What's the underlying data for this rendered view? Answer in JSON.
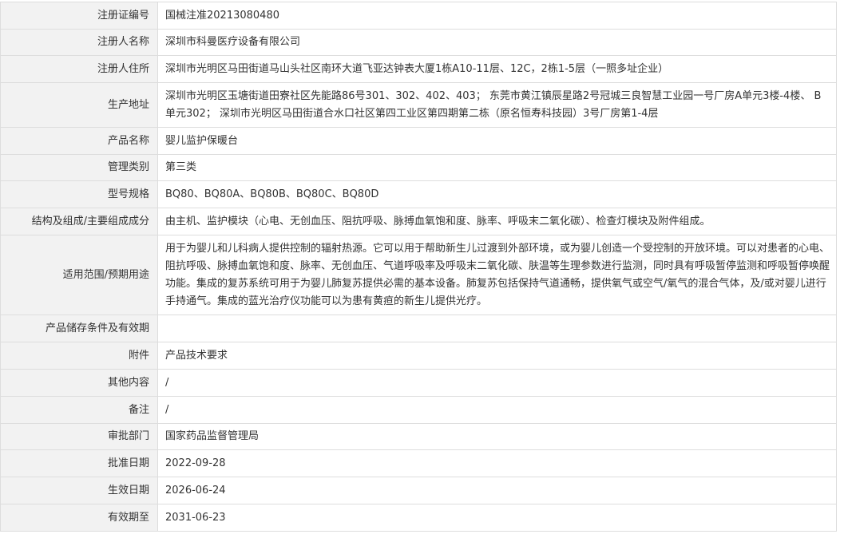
{
  "rows": [
    {
      "label": "注册证编号",
      "value": "国械注准20213080480"
    },
    {
      "label": "注册人名称",
      "value": "深圳市科曼医疗设备有限公司"
    },
    {
      "label": "注册人住所",
      "value": "深圳市光明区马田街道马山头社区南环大道飞亚达钟表大厦1栋A10-11层、12C，2栋1-5层（一照多址企业）"
    },
    {
      "label": "生产地址",
      "value": "深圳市光明区玉塘街道田寮社区先能路86号301、302、402、403； 东莞市黄江镇辰星路2号冠城三良智慧工业园一号厂房A单元3楼-4楼、 B单元302； 深圳市光明区马田街道合水口社区第四工业区第四期第二栋（原名恒寿科技园）3号厂房第1-4层"
    },
    {
      "label": "产品名称",
      "value": "婴儿监护保暖台"
    },
    {
      "label": "管理类别",
      "value": "第三类"
    },
    {
      "label": "型号规格",
      "value": "BQ80、BQ80A、BQ80B、BQ80C、BQ80D"
    },
    {
      "label": "结构及组成/主要组成成分",
      "value": "由主机、监护模块（心电、无创血压、阻抗呼吸、脉搏血氧饱和度、脉率、呼吸末二氧化碳）、检查灯模块及附件组成。"
    },
    {
      "label": "适用范围/预期用途",
      "value": "用于为婴儿和儿科病人提供控制的辐射热源。它可以用于帮助新生儿过渡到外部环境，或为婴儿创造一个受控制的开放环境。可以对患者的心电、阻抗呼吸、脉搏血氧饱和度、脉率、无创血压、气道呼吸率及呼吸末二氧化碳、肤温等生理参数进行监测，同时具有呼吸暂停监测和呼吸暂停唤醒功能。集成的复苏系统可用于为婴儿肺复苏提供必需的基本设备。肺复苏包括保持气道通畅，提供氧气或空气/氧气的混合气体，及/或对婴儿进行手持通气。集成的蓝光治疗仪功能可以为患有黄疸的新生儿提供光疗。"
    },
    {
      "label": "产品储存条件及有效期",
      "value": ""
    },
    {
      "label": "附件",
      "value": "产品技术要求"
    },
    {
      "label": "其他内容",
      "value": "/"
    },
    {
      "label": "备注",
      "value": "/"
    },
    {
      "label": "审批部门",
      "value": "国家药品监督管理局"
    },
    {
      "label": "批准日期",
      "value": "2022-09-28"
    },
    {
      "label": "生效日期",
      "value": "2026-06-24"
    },
    {
      "label": "有效期至",
      "value": "2031-06-23"
    }
  ]
}
